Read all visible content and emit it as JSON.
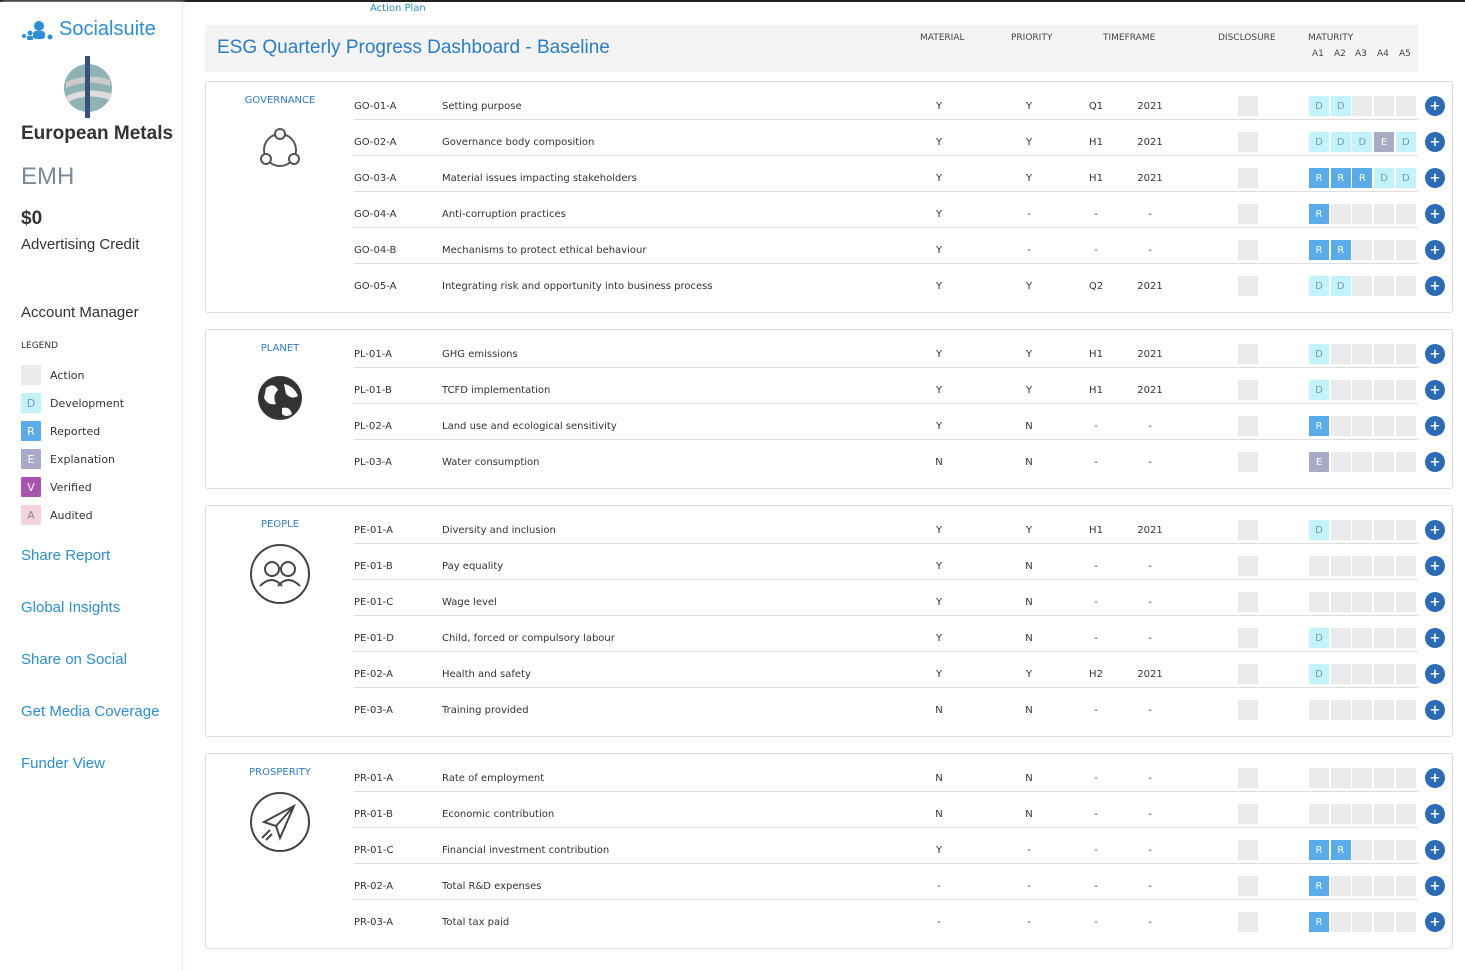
{
  "brand": "Socialsuite",
  "company": "European Metals",
  "ticker": "EMH",
  "credit_amount": "$0",
  "credit_label": "Advertising Credit",
  "account_manager": "Account Manager",
  "legend": {
    "title": "LEGEND",
    "items": [
      {
        "code": "",
        "label": "Action",
        "bg": "#ebebeb",
        "fg": "#888"
      },
      {
        "code": "D",
        "label": "Development",
        "bg": "#c2f2fa",
        "fg": "#7a9aa8"
      },
      {
        "code": "R",
        "label": "Reported",
        "bg": "#5aabea",
        "fg": "#ffffff"
      },
      {
        "code": "E",
        "label": "Explanation",
        "bg": "#a9abc6",
        "fg": "#ffffff"
      },
      {
        "code": "V",
        "label": "Verified",
        "bg": "#a855b0",
        "fg": "#ffffff"
      },
      {
        "code": "A",
        "label": "Audited",
        "bg": "#f5d3da",
        "fg": "#8a8a9a"
      }
    ]
  },
  "links": [
    "Share Report",
    "Global Insights",
    "Share on Social",
    "Get Media Coverage",
    "Funder View"
  ],
  "breadcrumb": "Action Plan",
  "title": "ESG Quarterly Progress Dashboard - Baseline",
  "columns": {
    "material": "MATERIAL",
    "priority": "PRIORITY",
    "timeframe": "TIMEFRAME",
    "disclosure": "DISCLOSURE",
    "maturity": "MATURITY",
    "maturity_levels": [
      "A1",
      "A2",
      "A3",
      "A4",
      "A5"
    ]
  },
  "sections": [
    {
      "name": "GOVERNANCE",
      "icon": "network-icon",
      "rows": [
        {
          "code": "GO-01-A",
          "name": "Setting purpose",
          "material": "Y",
          "priority": "Y",
          "timeframe": "Q1",
          "year": "2021",
          "maturity": [
            "D",
            "D",
            "",
            "",
            ""
          ]
        },
        {
          "code": "GO-02-A",
          "name": "Governance body composition",
          "material": "Y",
          "priority": "Y",
          "timeframe": "H1",
          "year": "2021",
          "maturity": [
            "D",
            "D",
            "D",
            "E",
            "D"
          ]
        },
        {
          "code": "GO-03-A",
          "name": "Material issues impacting stakeholders",
          "material": "Y",
          "priority": "Y",
          "timeframe": "H1",
          "year": "2021",
          "maturity": [
            "R",
            "R",
            "R",
            "D",
            "D"
          ]
        },
        {
          "code": "GO-04-A",
          "name": "Anti-corruption practices",
          "material": "Y",
          "priority": "-",
          "timeframe": "-",
          "year": "-",
          "maturity": [
            "R",
            "",
            "",
            "",
            ""
          ]
        },
        {
          "code": "GO-04-B",
          "name": "Mechanisms to protect ethical behaviour",
          "material": "Y",
          "priority": "-",
          "timeframe": "-",
          "year": "-",
          "maturity": [
            "R",
            "R",
            "",
            "",
            ""
          ]
        },
        {
          "code": "GO-05-A",
          "name": "Integrating risk and opportunity into business process",
          "material": "Y",
          "priority": "Y",
          "timeframe": "Q2",
          "year": "2021",
          "maturity": [
            "D",
            "D",
            "",
            "",
            ""
          ]
        }
      ]
    },
    {
      "name": "PLANET",
      "icon": "globe-icon",
      "rows": [
        {
          "code": "PL-01-A",
          "name": "GHG emissions",
          "material": "Y",
          "priority": "Y",
          "timeframe": "H1",
          "year": "2021",
          "maturity": [
            "D",
            "",
            "",
            "",
            ""
          ]
        },
        {
          "code": "PL-01-B",
          "name": "TCFD implementation",
          "material": "Y",
          "priority": "Y",
          "timeframe": "H1",
          "year": "2021",
          "maturity": [
            "D",
            "",
            "",
            "",
            ""
          ]
        },
        {
          "code": "PL-02-A",
          "name": "Land use and ecological sensitivity",
          "material": "Y",
          "priority": "N",
          "timeframe": "-",
          "year": "-",
          "maturity": [
            "R",
            "",
            "",
            "",
            ""
          ]
        },
        {
          "code": "PL-03-A",
          "name": "Water consumption",
          "material": "N",
          "priority": "N",
          "timeframe": "-",
          "year": "-",
          "maturity": [
            "E",
            "",
            "",
            "",
            ""
          ]
        }
      ]
    },
    {
      "name": "PEOPLE",
      "icon": "people-icon",
      "rows": [
        {
          "code": "PE-01-A",
          "name": "Diversity and inclusion",
          "material": "Y",
          "priority": "Y",
          "timeframe": "H1",
          "year": "2021",
          "maturity": [
            "D",
            "",
            "",
            "",
            ""
          ]
        },
        {
          "code": "PE-01-B",
          "name": "Pay equality",
          "material": "Y",
          "priority": "N",
          "timeframe": "-",
          "year": "-",
          "maturity": [
            "",
            "",
            "",
            "",
            ""
          ]
        },
        {
          "code": "PE-01-C",
          "name": "Wage level",
          "material": "Y",
          "priority": "N",
          "timeframe": "-",
          "year": "-",
          "maturity": [
            "",
            "",
            "",
            "",
            ""
          ]
        },
        {
          "code": "PE-01-D",
          "name": "Child, forced or compulsory labour",
          "material": "Y",
          "priority": "N",
          "timeframe": "-",
          "year": "-",
          "maturity": [
            "D",
            "",
            "",
            "",
            ""
          ]
        },
        {
          "code": "PE-02-A",
          "name": "Health and safety",
          "material": "Y",
          "priority": "Y",
          "timeframe": "H2",
          "year": "2021",
          "maturity": [
            "D",
            "",
            "",
            "",
            ""
          ]
        },
        {
          "code": "PE-03-A",
          "name": "Training provided",
          "material": "N",
          "priority": "N",
          "timeframe": "-",
          "year": "-",
          "maturity": [
            "",
            "",
            "",
            "",
            ""
          ]
        }
      ]
    },
    {
      "name": "PROSPERITY",
      "icon": "paper-plane-icon",
      "rows": [
        {
          "code": "PR-01-A",
          "name": "Rate of employment",
          "material": "N",
          "priority": "N",
          "timeframe": "-",
          "year": "-",
          "maturity": [
            "",
            "",
            "",
            "",
            ""
          ]
        },
        {
          "code": "PR-01-B",
          "name": "Economic contribution",
          "material": "N",
          "priority": "N",
          "timeframe": "-",
          "year": "-",
          "maturity": [
            "",
            "",
            "",
            "",
            ""
          ]
        },
        {
          "code": "PR-01-C",
          "name": "Financial investment contribution",
          "material": "Y",
          "priority": "-",
          "timeframe": "-",
          "year": "-",
          "maturity": [
            "R",
            "R",
            "",
            "",
            ""
          ]
        },
        {
          "code": "PR-02-A",
          "name": "Total R&D expenses",
          "material": "-",
          "priority": "-",
          "timeframe": "-",
          "year": "-",
          "maturity": [
            "R",
            "",
            "",
            "",
            ""
          ]
        },
        {
          "code": "PR-03-A",
          "name": "Total tax paid",
          "material": "-",
          "priority": "-",
          "timeframe": "-",
          "year": "-",
          "maturity": [
            "R",
            "",
            "",
            "",
            ""
          ]
        }
      ]
    }
  ]
}
